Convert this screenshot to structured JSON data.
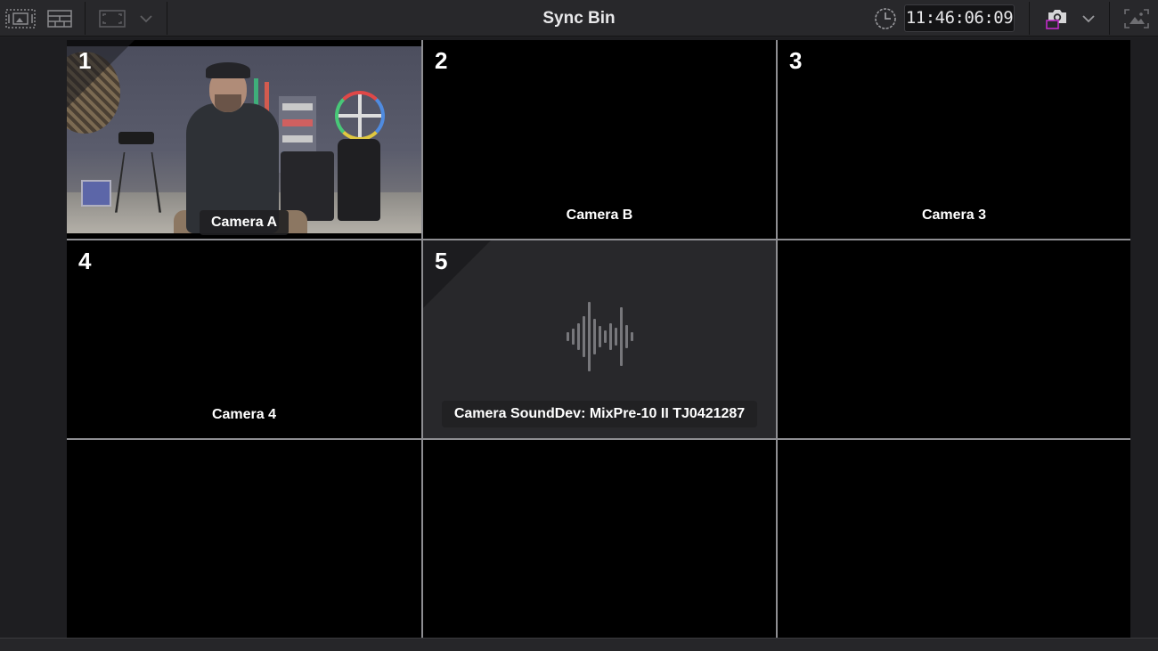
{
  "toolbar": {
    "title": "Sync Bin",
    "timecode": "11:46:06:09",
    "icons": {
      "filmstrip": "filmstrip-view-icon",
      "grid_layout": "grid-layout-icon",
      "frame": "viewer-frame-icon",
      "dropdown": "chevron-down-icon",
      "clock": "clock-icon",
      "camera": "camera-angle-icon",
      "camera_dropdown": "chevron-down-icon",
      "fullscreen": "expand-viewer-icon"
    },
    "accent_color": "#c02cc8"
  },
  "grid": {
    "cells": [
      {
        "number": "1",
        "label": "Camera A",
        "has_video": true
      },
      {
        "number": "2",
        "label": "Camera B"
      },
      {
        "number": "3",
        "label": "Camera 3"
      },
      {
        "number": "4",
        "label": "Camera 4"
      },
      {
        "number": "5",
        "label": "Camera SoundDev: MixPre-10 II TJ0421287",
        "audio": true
      },
      {
        "number": "",
        "label": ""
      },
      {
        "number": "",
        "label": ""
      },
      {
        "number": "",
        "label": ""
      },
      {
        "number": "",
        "label": ""
      }
    ]
  }
}
